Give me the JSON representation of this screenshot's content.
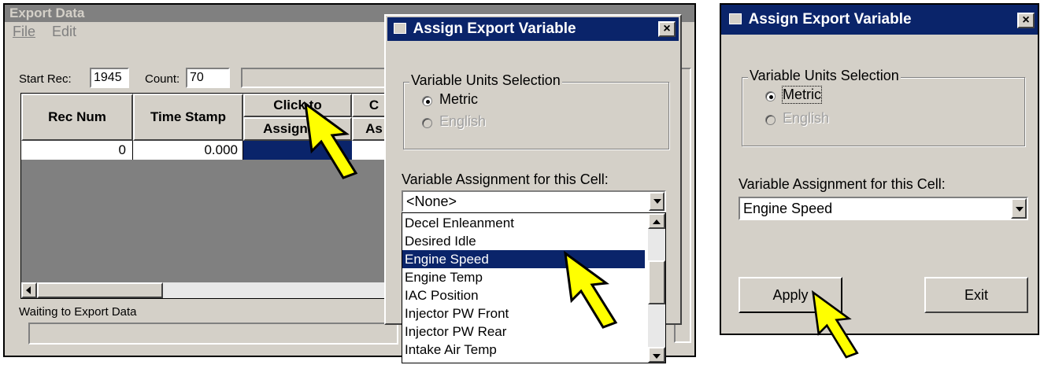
{
  "export_window": {
    "title": "Export Data",
    "menu": [
      "File",
      "Edit"
    ],
    "start_rec_label": "Start Rec:",
    "start_rec_value": "1945",
    "count_label": "Count:",
    "count_value": "70",
    "grid_headers": {
      "rec_num": "Rec Num",
      "time_stamp": "Time Stamp",
      "click_to_top": "Click to",
      "click_to_bottom": "Assign Var",
      "next_top": "C",
      "next_bottom": "As"
    },
    "grid_row": {
      "rec_num": "0",
      "time_stamp": "0.000"
    },
    "status_text": "Waiting to Export Data"
  },
  "dialog_left": {
    "title": "Assign Export Variable",
    "close_glyph": "×",
    "units_group_label": "Variable Units Selection",
    "metric_label": "Metric",
    "english_label": "English",
    "assignment_label": "Variable Assignment for this Cell:",
    "combo_value": "<None>",
    "list_items": [
      "Decel Enleanment",
      "Desired Idle",
      "Engine Speed",
      "Engine Temp",
      "IAC Position",
      "Injector PW Front",
      "Injector PW Rear",
      "Intake Air Temp"
    ],
    "selected_item": "Engine Speed"
  },
  "dialog_right": {
    "title": "Assign Export Variable",
    "close_glyph": "×",
    "units_group_label": "Variable Units Selection",
    "metric_label": "Metric",
    "english_label": "English",
    "assignment_label": "Variable Assignment for this Cell:",
    "combo_value": "Engine Speed",
    "apply_label": "Apply",
    "exit_label": "Exit"
  },
  "colors": {
    "title_active": "#0a246a",
    "selection": "#0a246a",
    "window_face": "#d4d0c8",
    "pointer_arrow": "#ffff00"
  }
}
